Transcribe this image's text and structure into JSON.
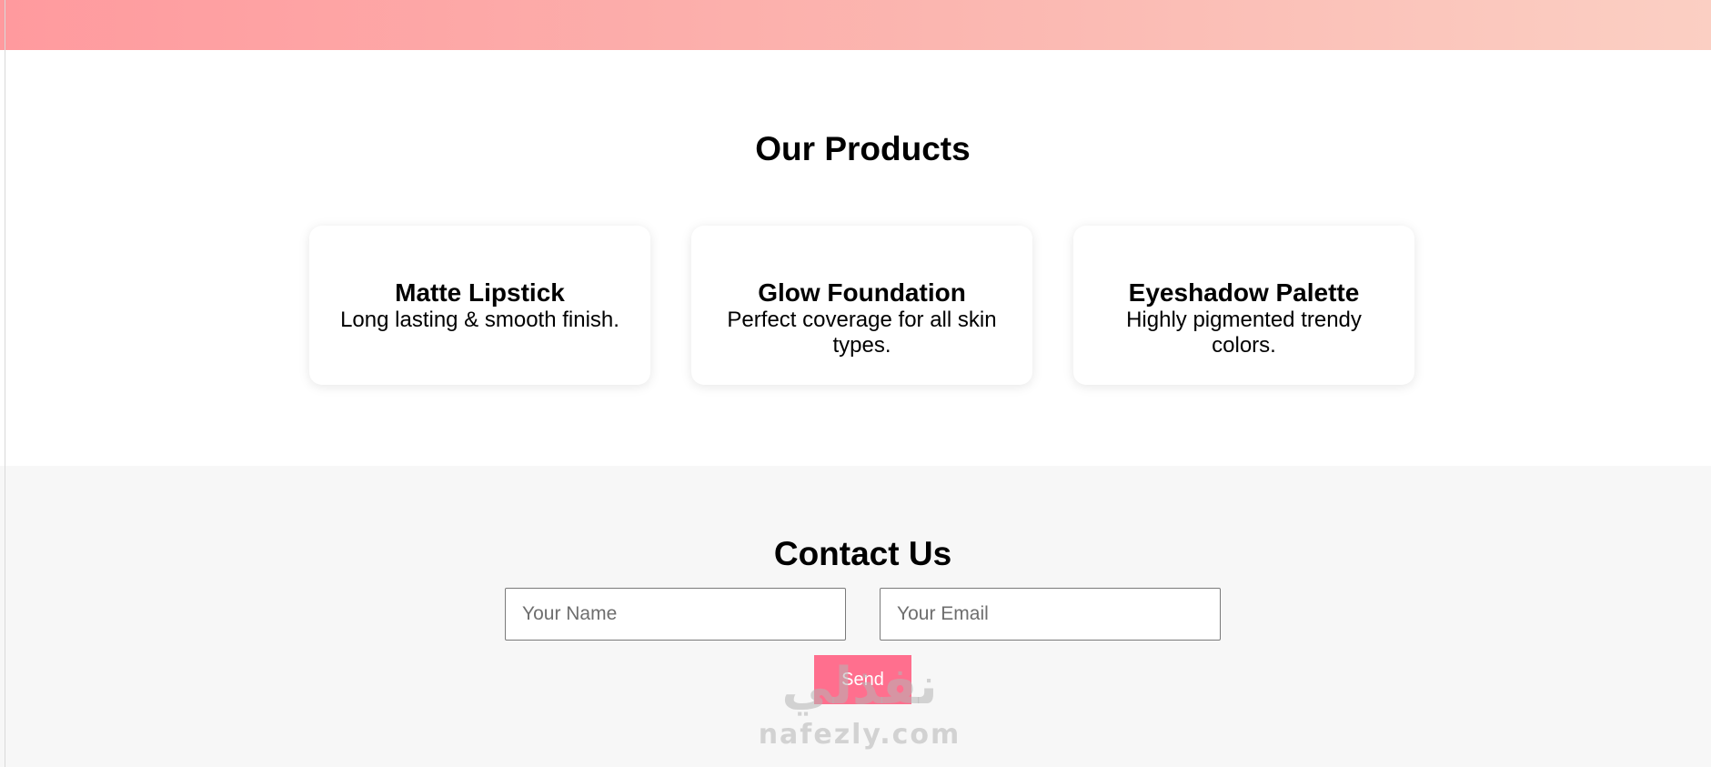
{
  "hero": {
    "gradient_start": "#ff9a9e",
    "gradient_end": "#fbcfc3"
  },
  "products": {
    "title": "Our Products",
    "items": [
      {
        "name": "Matte Lipstick",
        "description": "Long lasting & smooth finish."
      },
      {
        "name": "Glow Foundation",
        "description": "Perfect coverage for all skin types."
      },
      {
        "name": "Eyeshadow Palette",
        "description": "Highly pigmented trendy colors."
      }
    ]
  },
  "contact": {
    "title": "Contact Us",
    "name_placeholder": "Your Name",
    "name_value": "",
    "email_placeholder": "Your Email",
    "email_value": "",
    "send_label": "Send",
    "accent_color": "#ff6f8e"
  },
  "watermark": {
    "arabic": "نفذلي",
    "latin": "nafezly.com"
  }
}
